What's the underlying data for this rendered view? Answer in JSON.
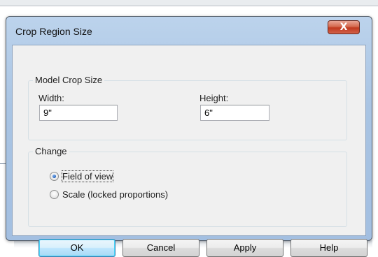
{
  "dialog": {
    "title": "Crop Region Size",
    "close_icon": "close-icon",
    "close_glyph": "X"
  },
  "model_crop": {
    "legend": "Model Crop Size",
    "width_label": "Width:",
    "width_value": "9\"",
    "height_label": "Height:",
    "height_value": "6\""
  },
  "change": {
    "legend": "Change",
    "options": [
      {
        "label": "Field of view",
        "checked": true
      },
      {
        "label": "Scale (locked proportions)",
        "checked": false
      }
    ]
  },
  "buttons": {
    "ok": "OK",
    "cancel": "Cancel",
    "apply": "Apply",
    "help": "Help"
  },
  "colors": {
    "title_bar": "#a9c4e3",
    "close_button": "#c0391e",
    "default_button_border": "#3c7fb1"
  }
}
